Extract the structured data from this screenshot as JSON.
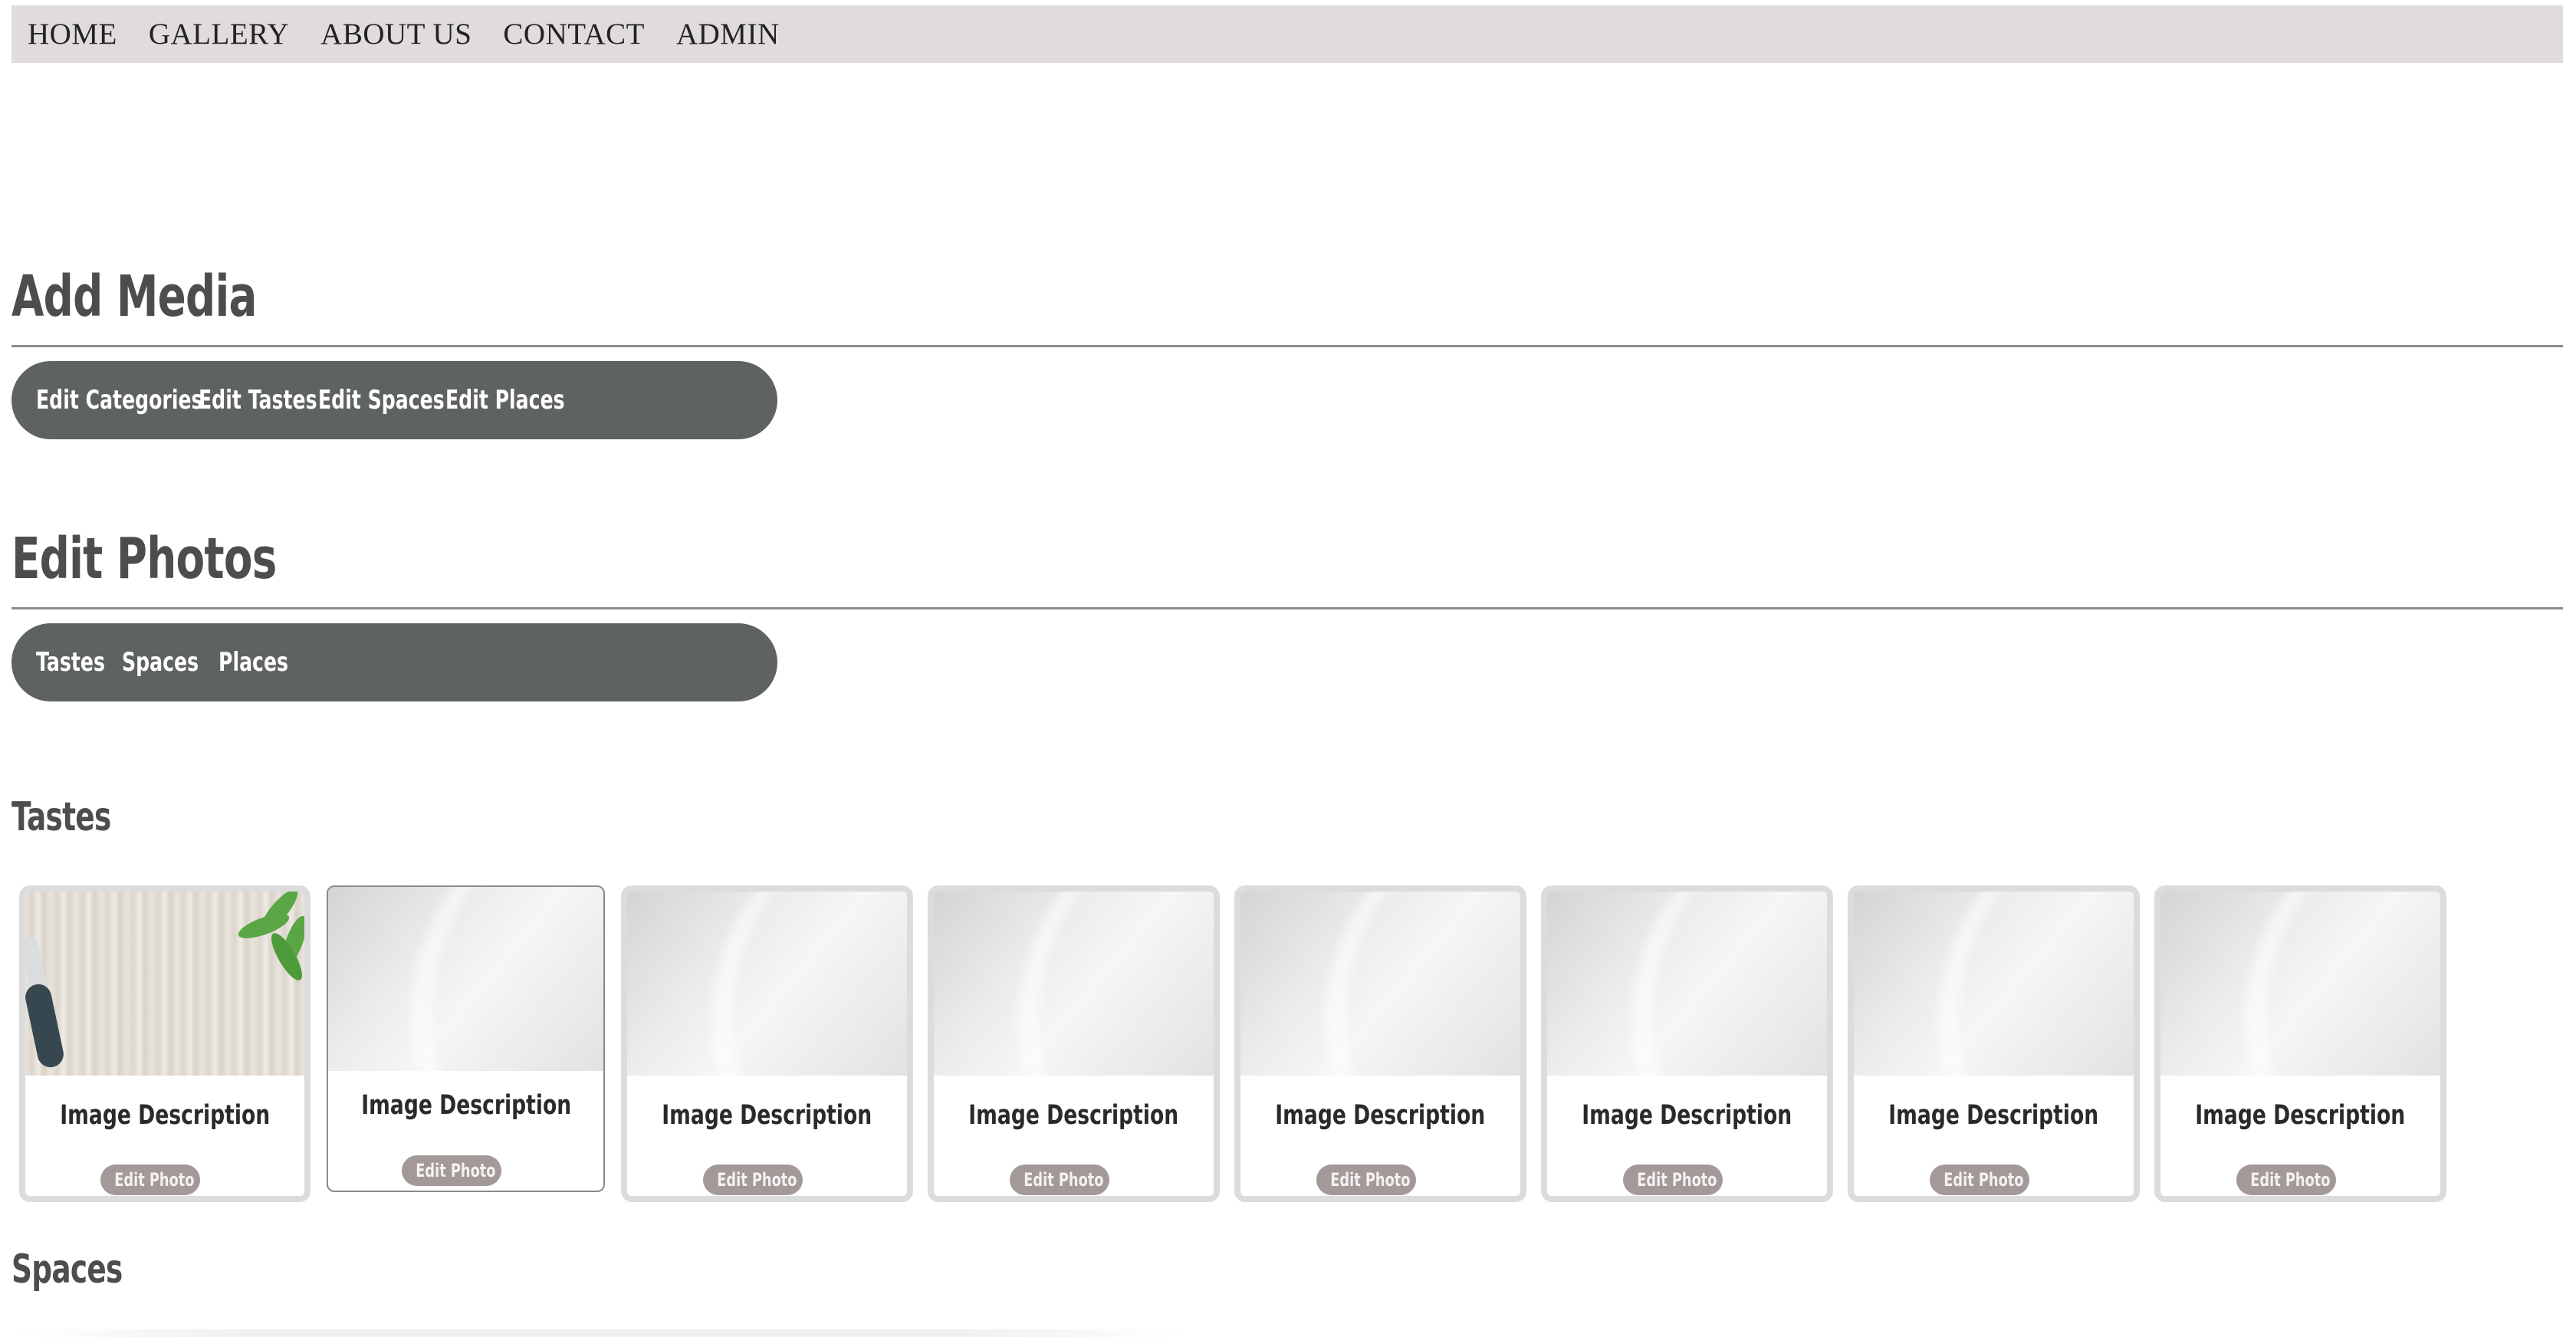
{
  "nav": {
    "items": [
      "HOME",
      "GALLERY",
      "ABOUT US",
      "CONTACT",
      "ADMIN"
    ]
  },
  "add_media": {
    "title": "Add Media",
    "buttons": [
      "Edit Categories",
      "Edit Tastes",
      "Edit Spaces",
      "Edit Places"
    ]
  },
  "edit_photos": {
    "title": "Edit Photos",
    "tabs": [
      "Tastes",
      "Spaces",
      "Places"
    ]
  },
  "tastes": {
    "title": "Tastes",
    "cards": [
      {
        "description": "Image Description",
        "button": "Edit Photo",
        "image": "knife-herbs-cutting-board"
      },
      {
        "description": "Image Description",
        "button": "Edit Photo",
        "image": "placeholder-gray"
      },
      {
        "description": "Image Description",
        "button": "Edit Photo",
        "image": "placeholder-gray"
      },
      {
        "description": "Image Description",
        "button": "Edit Photo",
        "image": "placeholder-gray"
      },
      {
        "description": "Image Description",
        "button": "Edit Photo",
        "image": "placeholder-gray"
      },
      {
        "description": "Image Description",
        "button": "Edit Photo",
        "image": "placeholder-gray"
      },
      {
        "description": "Image Description",
        "button": "Edit Photo",
        "image": "placeholder-gray"
      },
      {
        "description": "Image Description",
        "button": "Edit Photo",
        "image": "placeholder-gray"
      }
    ]
  },
  "spaces": {
    "title": "Spaces"
  },
  "colors": {
    "nav_bg": "#e0dcdc",
    "pill_bg": "#5e6263",
    "heading": "#4b4d4e",
    "edit_button": "#a49999"
  }
}
